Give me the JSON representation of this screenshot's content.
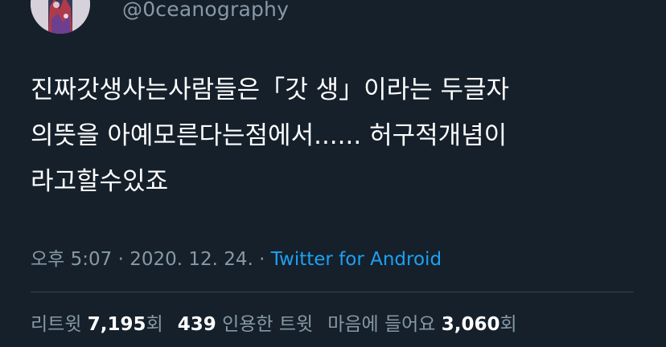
{
  "header": {
    "handle": "@0ceanography"
  },
  "tweet": {
    "text": "진짜갓생사는사람들은「갓 생」이라는 두글자\n의뜻을 아예모른다는점에서...... 허구적개념이\n라고할수있죠",
    "time": "오후 5:07",
    "date": "2020. 12. 24.",
    "separator": "·",
    "source": "Twitter for Android"
  },
  "stats": {
    "retweets_label": "리트윗",
    "retweets_count": "7,195",
    "retweets_suffix": "회",
    "quotes_count": "439",
    "quotes_label": "인용한 트윗",
    "likes_label": "마음에 들어요",
    "likes_count": "3,060",
    "likes_suffix": "회"
  },
  "colors": {
    "background": "#15202b",
    "text": "#ffffff",
    "muted": "#8899a6",
    "link": "#1da1f2",
    "divider": "#38444d"
  }
}
